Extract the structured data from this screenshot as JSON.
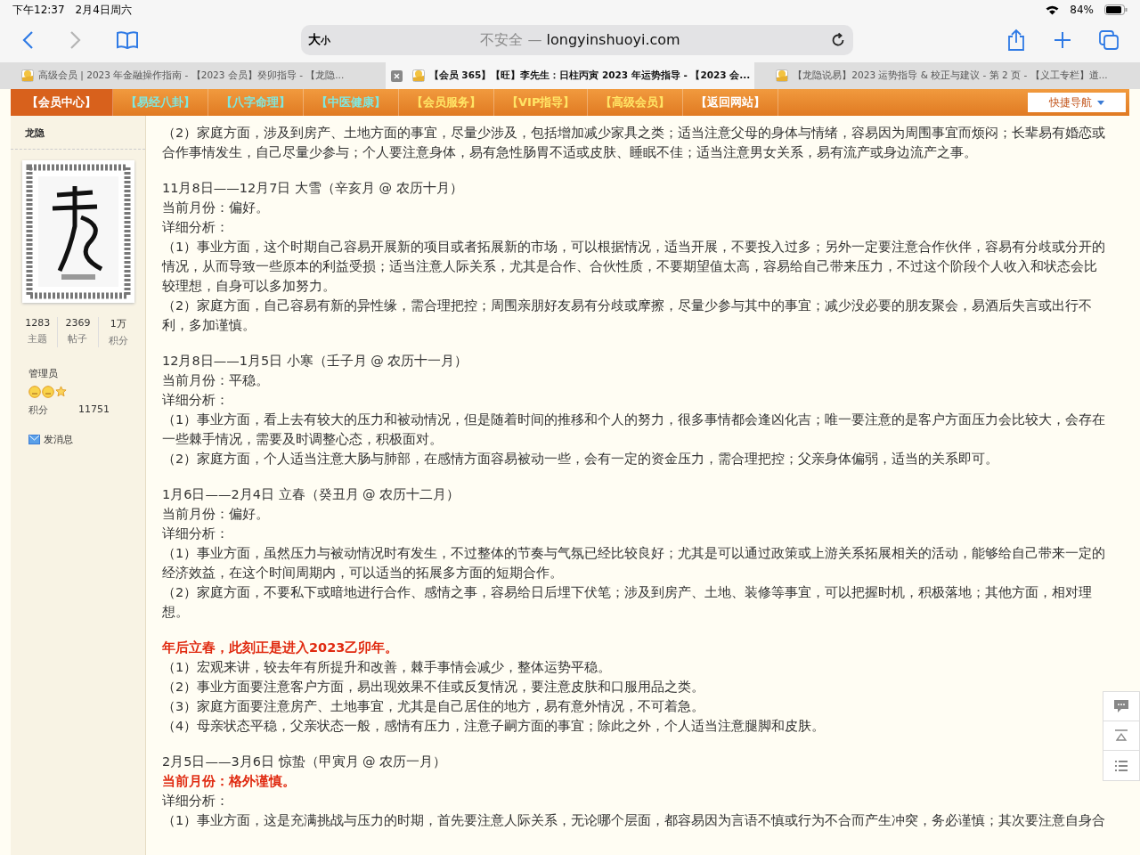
{
  "status_bar": {
    "time": "下午12:37",
    "date": "2月4日周六",
    "battery": "84%"
  },
  "toolbar": {
    "text_size": "大",
    "text_size_small": "小",
    "security": "不安全 —",
    "url": "longyinshuoyi.com"
  },
  "tabs": [
    {
      "title": "高级会员 | 2023 年金融操作指南 - 【2023 会员】癸卯指导 - 【龙隐...",
      "selected": false
    },
    {
      "title": "【会员 365】【旺】李先生：日柱丙寅 2023 年运势指导 - 【2023 会...",
      "selected": true
    },
    {
      "title": "【龙隐说易】2023 运势指导 & 校正与建议 - 第 2 页 - 【义工专栏】道...",
      "selected": false
    }
  ],
  "nav": {
    "items": [
      {
        "label": "【会员中心】",
        "selected": true,
        "kind": "site"
      },
      {
        "label": "【易经八卦】",
        "selected": false,
        "kind": "topic"
      },
      {
        "label": "【八字命理】",
        "selected": false,
        "kind": "topic"
      },
      {
        "label": "【中医健康】",
        "selected": false,
        "kind": "topic"
      },
      {
        "label": "【会员服务】",
        "selected": false,
        "kind": "service"
      },
      {
        "label": "【VIP指导】",
        "selected": false,
        "kind": "service"
      },
      {
        "label": "【高级会员】",
        "selected": false,
        "kind": "service"
      },
      {
        "label": "【返回网站】",
        "selected": false,
        "kind": "site"
      }
    ],
    "quick_nav": "快捷导航"
  },
  "profile": {
    "name": "龙隐",
    "stats": [
      {
        "value": "1283",
        "label": "主题"
      },
      {
        "value": "2369",
        "label": "帖子"
      },
      {
        "value": "1万",
        "label": "积分"
      }
    ],
    "group": "管理员",
    "points_label": "积分",
    "points": "11751",
    "message": "发消息"
  },
  "post": [
    {
      "lines": [
        {
          "kind": "text",
          "text": "（2）家庭方面，涉及到房产、土地方面的事宜，尽量少涉及，包括增加减少家具之类；适当注意父母的身体与情绪，容易因为周围事宜而烦闷；长辈易有婚恋或合作事情发生，自己尽量少参与；个人要注意身体，易有急性肠胃不适或皮肤、睡眠不佳；适当注意男女关系，易有流产或身边流产之事。"
        }
      ]
    },
    {
      "lines": [
        {
          "kind": "text",
          "text": "11月8日——12月7日 大雪（辛亥月 @ 农历十月）"
        },
        {
          "kind": "text",
          "text": "当前月份：偏好。"
        },
        {
          "kind": "text",
          "text": "详细分析："
        },
        {
          "kind": "text",
          "text": "（1）事业方面，这个时期自己容易开展新的项目或者拓展新的市场，可以根据情况，适当开展，不要投入过多；另外一定要注意合作伙伴，容易有分歧或分开的情况，从而导致一些原本的利益受损；适当注意人际关系，尤其是合作、合伙性质，不要期望值太高，容易给自己带来压力，不过这个阶段个人收入和状态会比较理想，自身可以多加努力。"
        },
        {
          "kind": "text",
          "text": "（2）家庭方面，自己容易有新的异性缘，需合理把控；周围亲朋好友易有分歧或摩擦，尽量少参与其中的事宜；减少没必要的朋友聚会，易酒后失言或出行不利，多加谨慎。"
        }
      ]
    },
    {
      "lines": [
        {
          "kind": "text",
          "text": "12月8日——1月5日 小寒（壬子月 @ 农历十一月）"
        },
        {
          "kind": "text",
          "text": "当前月份：平稳。"
        },
        {
          "kind": "text",
          "text": "详细分析："
        },
        {
          "kind": "text",
          "text": "（1）事业方面，看上去有较大的压力和被动情况，但是随着时间的推移和个人的努力，很多事情都会逢凶化吉；唯一要注意的是客户方面压力会比较大，会存在一些棘手情况，需要及时调整心态，积极面对。"
        },
        {
          "kind": "text",
          "text": "（2）家庭方面，个人适当注意大肠与肺部，在感情方面容易被动一些，会有一定的资金压力，需合理把控；父亲身体偏弱，适当的关系即可。"
        }
      ]
    },
    {
      "lines": [
        {
          "kind": "text",
          "text": "1月6日——2月4日 立春（癸丑月 @ 农历十二月）"
        },
        {
          "kind": "text",
          "text": "当前月份：偏好。"
        },
        {
          "kind": "text",
          "text": "详细分析："
        },
        {
          "kind": "text",
          "text": "（1）事业方面，虽然压力与被动情况时有发生，不过整体的节奏与气氛已经比较良好；尤其是可以通过政策或上游关系拓展相关的活动，能够给自己带来一定的经济效益，在这个时间周期内，可以适当的拓展多方面的短期合作。"
        },
        {
          "kind": "text",
          "text": "（2）家庭方面，不要私下或暗地进行合作、感情之事，容易给日后埋下伏笔；涉及到房产、土地、装修等事宜，可以把握时机，积极落地；其他方面，相对理想。"
        }
      ]
    },
    {
      "lines": [
        {
          "kind": "alert",
          "text": "年后立春，此刻正是进入2023乙卯年。"
        },
        {
          "kind": "text",
          "text": "（1）宏观来讲，较去年有所提升和改善，棘手事情会减少，整体运势平稳。"
        },
        {
          "kind": "text",
          "text": "（2）事业方面要注意客户方面，易出现效果不佳或反复情况，要注意皮肤和口服用品之类。"
        },
        {
          "kind": "text",
          "text": "（3）家庭方面要注意房产、土地事宜，尤其是自己居住的地方，易有意外情况，不可着急。"
        },
        {
          "kind": "text",
          "text": "（4）母亲状态平稳，父亲状态一般，感情有压力，注意子嗣方面的事宜；除此之外，个人适当注意腿脚和皮肤。"
        }
      ]
    },
    {
      "lines": [
        {
          "kind": "text",
          "text": "2月5日——3月6日 惊蛰（甲寅月 @ 农历一月）"
        },
        {
          "kind": "alert",
          "text": "当前月份：格外谨慎。"
        },
        {
          "kind": "text",
          "text": "详细分析："
        },
        {
          "kind": "text",
          "text": "（1）事业方面，这是充满挑战与压力的时期，首先要注意人际关系，无论哪个层面，都容易因为言语不慎或行为不合而产生冲突，务必谨慎；其次要注意自身合"
        }
      ]
    }
  ]
}
